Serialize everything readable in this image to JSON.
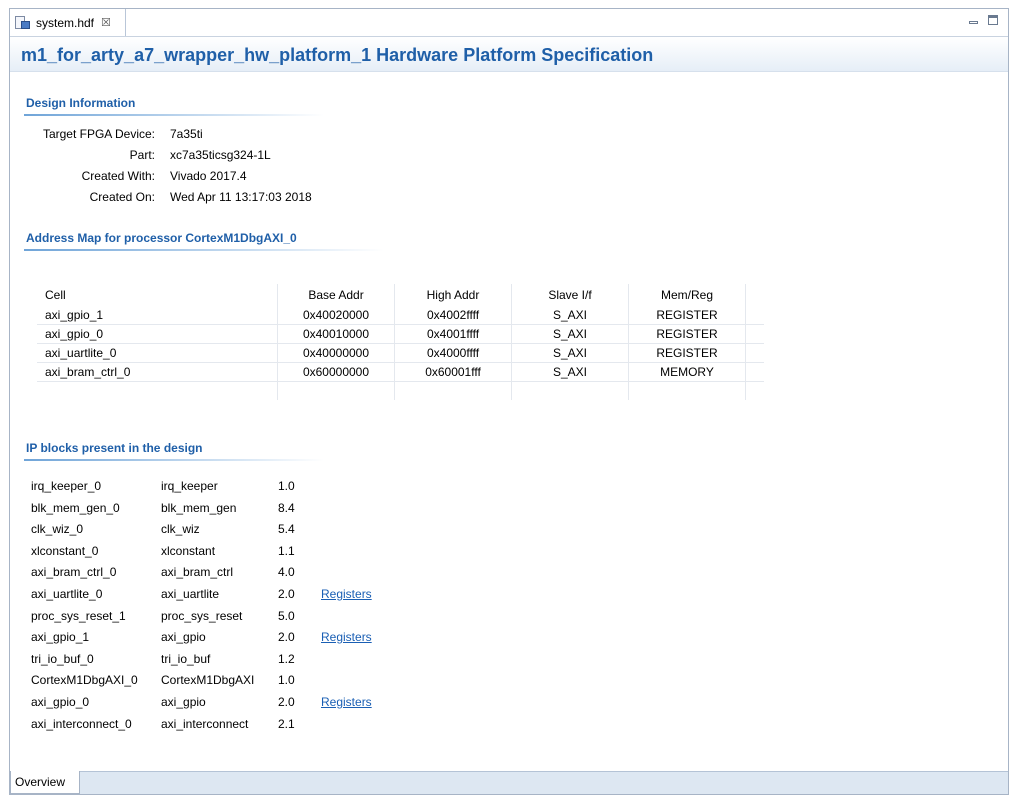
{
  "editor_tab": {
    "label": "system.hdf",
    "close_glyph": "☒"
  },
  "page_title": "m1_for_arty_a7_wrapper_hw_platform_1 Hardware Platform Specification",
  "design_info": {
    "heading": "Design Information",
    "rows": [
      {
        "label": "Target FPGA Device:",
        "value": "7a35ti"
      },
      {
        "label": "Part:",
        "value": "xc7a35ticsg324-1L"
      },
      {
        "label": "Created With:",
        "value": "Vivado 2017.4"
      },
      {
        "label": "Created On:",
        "value": "Wed Apr 11 13:17:03 2018"
      }
    ]
  },
  "address_map": {
    "heading": "Address Map for processor CortexM1DbgAXI_0",
    "columns": [
      "Cell",
      "Base Addr",
      "High Addr",
      "Slave I/f",
      "Mem/Reg"
    ],
    "rows": [
      [
        "axi_gpio_1",
        "0x40020000",
        "0x4002ffff",
        "S_AXI",
        "REGISTER"
      ],
      [
        "axi_gpio_0",
        "0x40010000",
        "0x4001ffff",
        "S_AXI",
        "REGISTER"
      ],
      [
        "axi_uartlite_0",
        "0x40000000",
        "0x4000ffff",
        "S_AXI",
        "REGISTER"
      ],
      [
        "axi_bram_ctrl_0",
        "0x60000000",
        "0x60001fff",
        "S_AXI",
        "MEMORY"
      ]
    ]
  },
  "ip_blocks": {
    "heading": "IP blocks present in the design",
    "rows": [
      {
        "name": "irq_keeper_0",
        "type": "irq_keeper",
        "version": "1.0",
        "link": ""
      },
      {
        "name": "blk_mem_gen_0",
        "type": "blk_mem_gen",
        "version": "8.4",
        "link": ""
      },
      {
        "name": "clk_wiz_0",
        "type": "clk_wiz",
        "version": "5.4",
        "link": ""
      },
      {
        "name": "xlconstant_0",
        "type": "xlconstant",
        "version": "1.1",
        "link": ""
      },
      {
        "name": "axi_bram_ctrl_0",
        "type": "axi_bram_ctrl",
        "version": "4.0",
        "link": ""
      },
      {
        "name": "axi_uartlite_0",
        "type": "axi_uartlite",
        "version": "2.0",
        "link": "Registers"
      },
      {
        "name": "proc_sys_reset_1",
        "type": "proc_sys_reset",
        "version": "5.0",
        "link": ""
      },
      {
        "name": "axi_gpio_1",
        "type": "axi_gpio",
        "version": "2.0",
        "link": "Registers"
      },
      {
        "name": "tri_io_buf_0",
        "type": "tri_io_buf",
        "version": "1.2",
        "link": ""
      },
      {
        "name": "CortexM1DbgAXI_0",
        "type": "CortexM1DbgAXI",
        "version": "1.0",
        "link": ""
      },
      {
        "name": "axi_gpio_0",
        "type": "axi_gpio",
        "version": "2.0",
        "link": "Registers"
      },
      {
        "name": "axi_interconnect_0",
        "type": "axi_interconnect",
        "version": "2.1",
        "link": ""
      }
    ]
  },
  "bottom_tab": {
    "label": "Overview"
  },
  "colors": {
    "heading_blue": "#1f5fa8",
    "link_blue": "#1a5fb4",
    "frame_border": "#a7b4c6"
  }
}
